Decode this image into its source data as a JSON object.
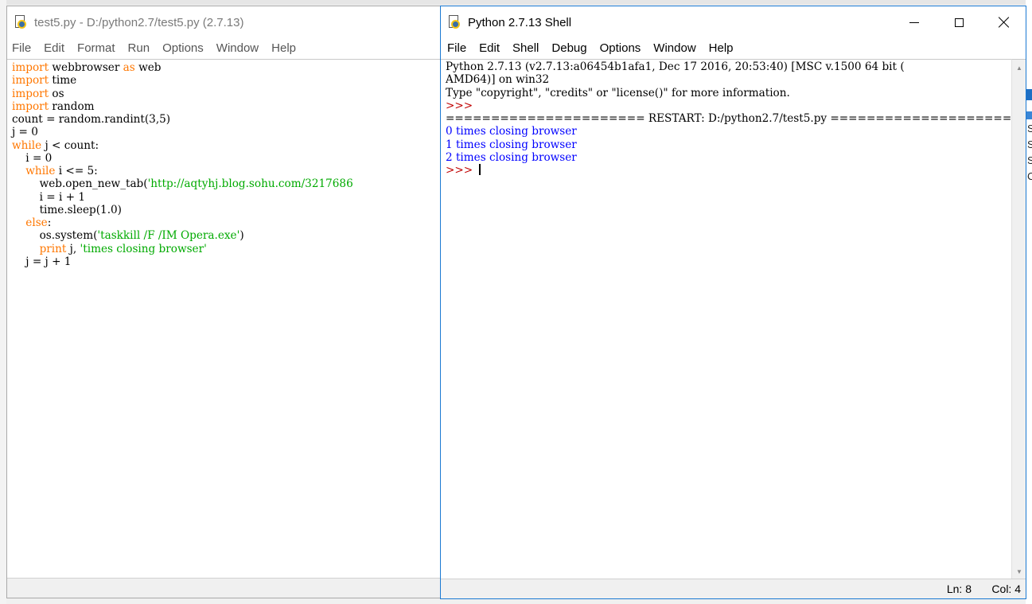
{
  "editor": {
    "title": "test5.py - D:/python2.7/test5.py (2.7.13)",
    "menu": [
      "File",
      "Edit",
      "Format",
      "Run",
      "Options",
      "Window",
      "Help"
    ],
    "code_lines": [
      [
        {
          "t": "import",
          "c": "kw"
        },
        {
          "t": " webbrowser "
        },
        {
          "t": "as",
          "c": "kw"
        },
        {
          "t": " web"
        }
      ],
      [
        {
          "t": "import",
          "c": "kw"
        },
        {
          "t": " time"
        }
      ],
      [
        {
          "t": "import",
          "c": "kw"
        },
        {
          "t": " os"
        }
      ],
      [
        {
          "t": "import",
          "c": "kw"
        },
        {
          "t": " random"
        }
      ],
      [
        {
          "t": "count = random.randint(3,5)"
        }
      ],
      [
        {
          "t": "j = 0"
        }
      ],
      [
        {
          "t": "while",
          "c": "kw"
        },
        {
          "t": " j < count:"
        }
      ],
      [
        {
          "t": "    i = 0"
        }
      ],
      [
        {
          "t": "    "
        },
        {
          "t": "while",
          "c": "kw"
        },
        {
          "t": " i <= 5:"
        }
      ],
      [
        {
          "t": "        web.open_new_tab("
        },
        {
          "t": "'http://aqtyhj.blog.sohu.com/3217686",
          "c": "str"
        }
      ],
      [
        {
          "t": "        i = i + 1"
        }
      ],
      [
        {
          "t": "        time.sleep(1.0)"
        }
      ],
      [
        {
          "t": "    "
        },
        {
          "t": "else",
          "c": "kw"
        },
        {
          "t": ":"
        }
      ],
      [
        {
          "t": "        os.system("
        },
        {
          "t": "'taskkill /F /IM Opera.exe'",
          "c": "str"
        },
        {
          "t": ")"
        }
      ],
      [
        {
          "t": "        "
        },
        {
          "t": "print",
          "c": "kw"
        },
        {
          "t": " j, "
        },
        {
          "t": "'times closing browser'",
          "c": "str"
        }
      ],
      [
        {
          "t": "    j = j + 1"
        }
      ]
    ]
  },
  "shell": {
    "title": "Python 2.7.13 Shell",
    "menu": [
      "File",
      "Edit",
      "Shell",
      "Debug",
      "Options",
      "Window",
      "Help"
    ],
    "output_lines": [
      [
        {
          "t": "Python 2.7.13 (v2.7.13:a06454b1afa1, Dec 17 2016, 20:53:40) [MSC v.1500 64 bit ("
        }
      ],
      [
        {
          "t": "AMD64)] on win32"
        }
      ],
      [
        {
          "t": "Type \"copyright\", \"credits\" or \"license()\" for more information."
        }
      ],
      [
        {
          "t": ">>> ",
          "c": "prompt"
        }
      ],
      [
        {
          "t": "====================== RESTART: D:/python2.7/test5.py ======================="
        }
      ],
      [
        {
          "t": "0 times closing browser",
          "c": "out"
        }
      ],
      [
        {
          "t": "1 times closing browser",
          "c": "out"
        }
      ],
      [
        {
          "t": "2 times closing browser",
          "c": "out"
        }
      ]
    ],
    "final_prompt": ">>>",
    "status": {
      "line": "Ln: 8",
      "col": "Col: 4"
    }
  },
  "side_glyphs": [
    "S",
    "S",
    "S",
    "C"
  ]
}
